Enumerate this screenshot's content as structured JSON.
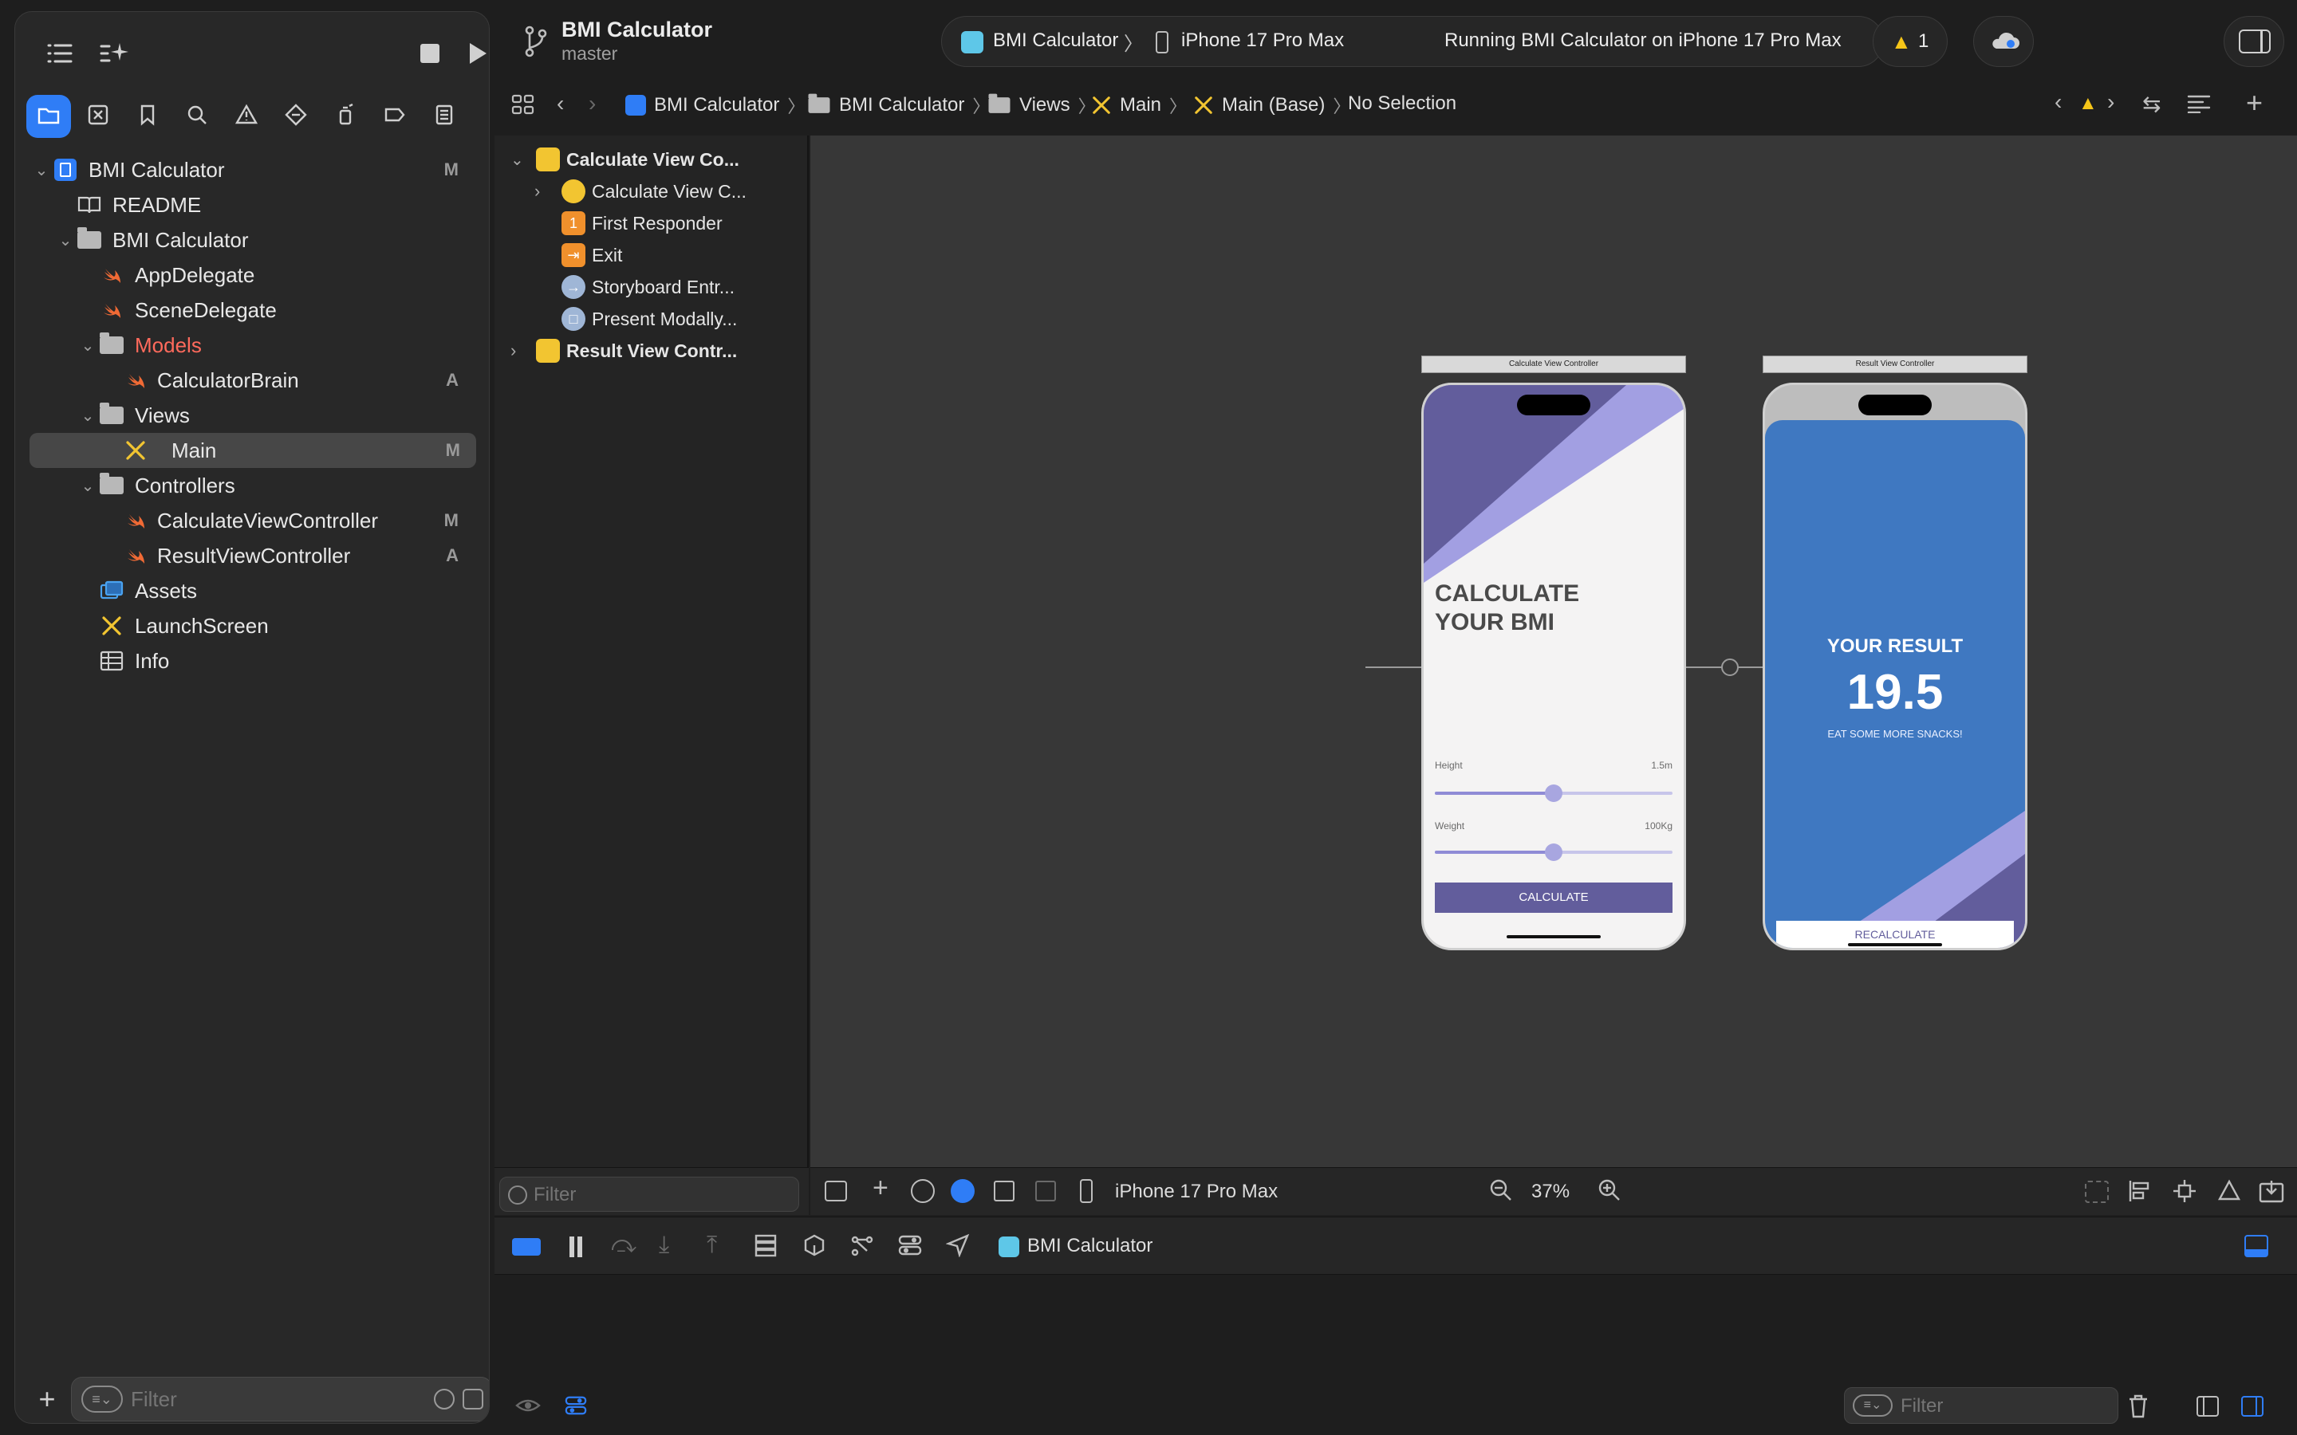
{
  "project": {
    "name": "BMI Calculator",
    "branch": "master"
  },
  "scheme": {
    "target": "BMI Calculator",
    "device": "iPhone 17 Pro Max",
    "status": "Running BMI Calculator on iPhone 17 Pro Max"
  },
  "warnings": {
    "count": "1"
  },
  "navigator": {
    "tree": [
      {
        "label": "BMI Calculator",
        "badge": "M"
      },
      {
        "label": "README",
        "badge": ""
      },
      {
        "label": "BMI Calculator",
        "badge": ""
      },
      {
        "label": "AppDelegate",
        "badge": ""
      },
      {
        "label": "SceneDelegate",
        "badge": ""
      },
      {
        "label": "Models",
        "badge": ""
      },
      {
        "label": "CalculatorBrain",
        "badge": "A"
      },
      {
        "label": "Views",
        "badge": ""
      },
      {
        "label": "Main",
        "badge": "M"
      },
      {
        "label": "Controllers",
        "badge": ""
      },
      {
        "label": "CalculateViewController",
        "badge": "M"
      },
      {
        "label": "ResultViewController",
        "badge": "A"
      },
      {
        "label": "Assets",
        "badge": ""
      },
      {
        "label": "LaunchScreen",
        "badge": ""
      },
      {
        "label": "Info",
        "badge": ""
      }
    ],
    "filter_placeholder": "Filter"
  },
  "jumpbar": {
    "crumbs": [
      "BMI Calculator",
      "BMI Calculator",
      "Views",
      "Main",
      "Main (Base)",
      "No Selection"
    ]
  },
  "outline": {
    "rows": [
      "Calculate View Co...",
      "Calculate View C...",
      "First Responder",
      "Exit",
      "Storyboard Entr...",
      "Present Modally...",
      "Result View Contr..."
    ],
    "filter_placeholder": "Filter"
  },
  "canvas": {
    "device": "iPhone 17 Pro Max",
    "zoom": "37%",
    "calc_scene": {
      "title": "Calculate View Controller",
      "heading_line1": "CALCULATE",
      "heading_line2": "YOUR BMI",
      "height_label": "Height",
      "height_value": "1.5m",
      "weight_label": "Weight",
      "weight_value": "100Kg",
      "button": "CALCULATE",
      "height_slider": 0.5,
      "weight_slider": 0.5
    },
    "result_scene": {
      "title": "Result View Controller",
      "heading": "YOUR RESULT",
      "value": "19.5",
      "advice": "EAT SOME MORE SNACKS!",
      "button": "RECALCULATE"
    }
  },
  "debug": {
    "target": "BMI Calculator",
    "filter_placeholder": "Filter"
  },
  "colors": {
    "accent": "#2f7df6",
    "calc_dark_purple": "#625d9c",
    "calc_light_purple": "#a29fe2",
    "result_blue": "#3f78c1"
  }
}
